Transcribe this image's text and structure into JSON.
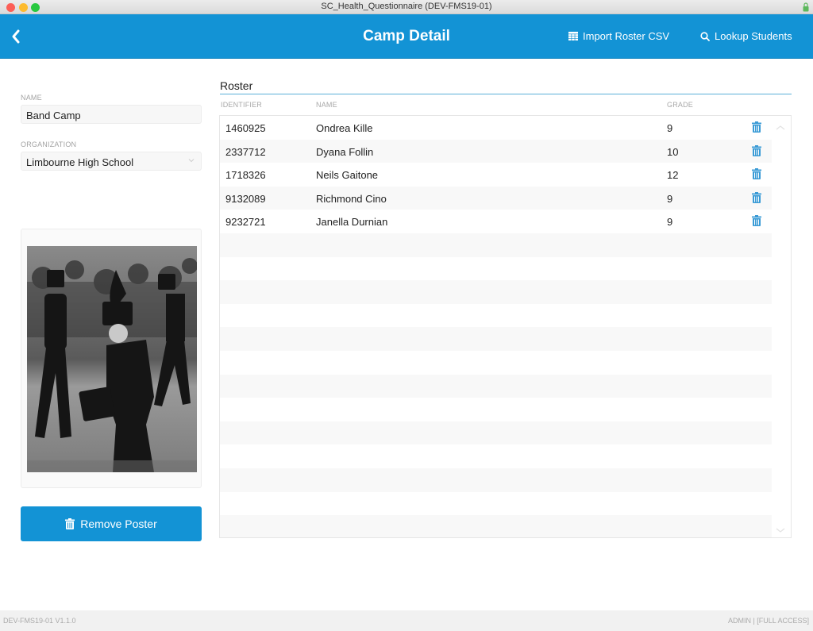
{
  "window": {
    "title": "SC_Health_Questionnaire (DEV-FMS19-01)"
  },
  "header": {
    "title": "Camp Detail",
    "import_label": "Import Roster CSV",
    "lookup_label": "Lookup Students",
    "accent_color": "#1393d5"
  },
  "form": {
    "name_label": "NAME",
    "name_value": "Band Camp",
    "org_label": "ORGANIZATION",
    "org_value": "Limbourne High School"
  },
  "poster": {
    "remove_label": "Remove Poster"
  },
  "roster": {
    "title": "Roster",
    "columns": [
      "IDENTIFIER",
      "NAME",
      "GRADE"
    ],
    "rows": [
      {
        "id": "1460925",
        "name": "Ondrea Kille",
        "grade": "9"
      },
      {
        "id": "2337712",
        "name": "Dyana Follin",
        "grade": "10"
      },
      {
        "id": "1718326",
        "name": "Neils Gaitone",
        "grade": "12"
      },
      {
        "id": "9132089",
        "name": "Richmond Cino",
        "grade": "9"
      },
      {
        "id": "9232721",
        "name": "Janella Durnian",
        "grade": "9"
      }
    ]
  },
  "footer": {
    "version": "DEV-FMS19-01 V1.1.0",
    "access": "ADMIN | [FULL ACCESS]"
  }
}
